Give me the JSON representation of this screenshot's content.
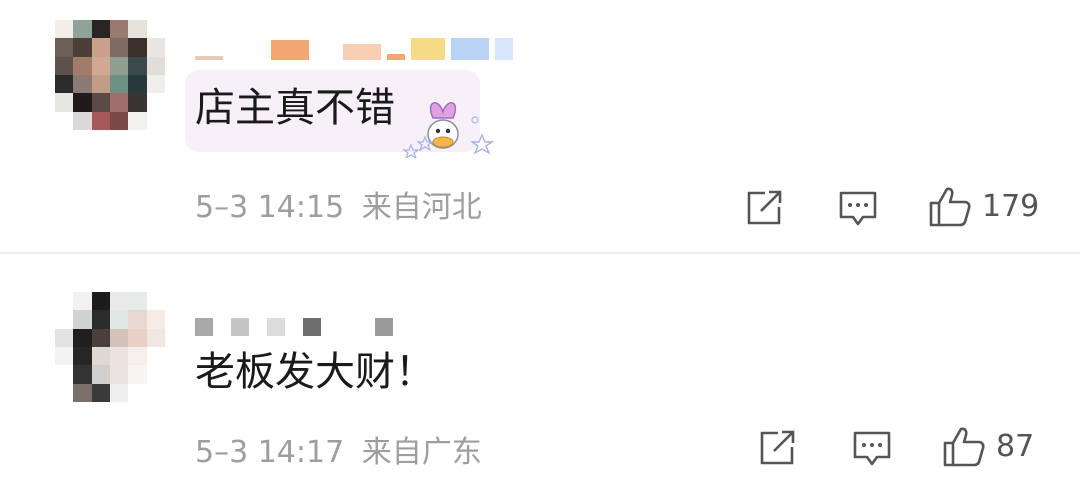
{
  "comments": [
    {
      "text": "店主真不错",
      "time": "5–3 14:15",
      "location": "来自河北",
      "likes": "179"
    },
    {
      "text": "老板发大财！",
      "time": "5–3 14:17",
      "location": "来自广东",
      "likes": "87"
    }
  ],
  "icons": {
    "share": "share-icon",
    "comment": "comment-icon",
    "like": "thumbs-up-icon"
  }
}
